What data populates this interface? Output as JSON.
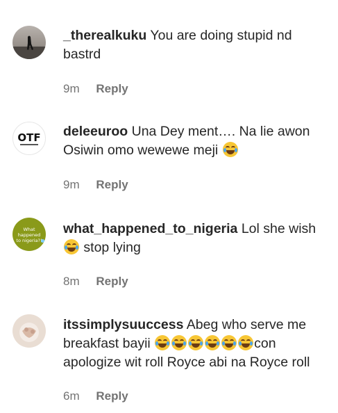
{
  "comments": [
    {
      "username": "_therealkuku",
      "text": "You are doing stupid nd bastrd",
      "time": "9m",
      "reply": "Reply",
      "avatar": "photo-silhouette-avatar"
    },
    {
      "username": "deleeuroo",
      "text_before": "Una Dey ment…. Na lie awon Osiwin omo wewewe meji",
      "emoji_count": 1,
      "emoji": "face-with-tears-of-joy",
      "time": "9m",
      "reply": "Reply",
      "avatar": "OTF"
    },
    {
      "username": "what_happened_to_nigeria",
      "text_before": "Lol she wish",
      "emoji": "face-with-tears-of-joy",
      "text_after": "stop lying",
      "time": "8m",
      "reply": "Reply",
      "avatar_text": "What happened to nigeria?!"
    },
    {
      "username": "itssimplysuuccess",
      "text_before": "Abeg who serve me breakfast bayii",
      "emoji_count": 6,
      "emoji": "face-with-tears-of-joy",
      "text_after": "con apologize wit roll Royce abi na Royce roll",
      "time": "6m",
      "reply": "Reply",
      "avatar": "photo-avatar"
    }
  ],
  "colors": {
    "text": "#262626",
    "meta": "#737373",
    "emoji": "#f7c635",
    "avatar3_bg": "#8a9a1a"
  }
}
